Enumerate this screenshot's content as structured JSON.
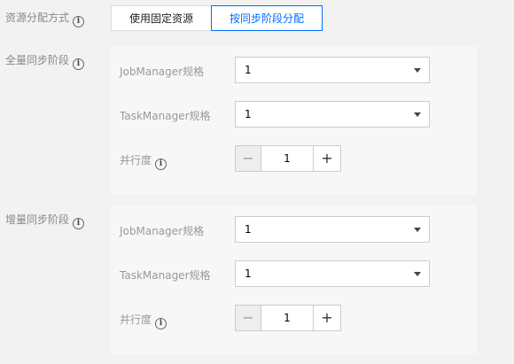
{
  "allocation": {
    "label": "资源分配方式",
    "options": [
      "使用固定资源",
      "按同步阶段分配"
    ],
    "selected": "按同步阶段分配"
  },
  "full_stage": {
    "label": "全量同步阶段",
    "jobmanager_label": "JobManager规格",
    "jobmanager_value": "1",
    "taskmanager_label": "TaskManager规格",
    "taskmanager_value": "1",
    "parallelism_label": "并行度",
    "parallelism_value": "1"
  },
  "incremental_stage": {
    "label": "增量同步阶段",
    "jobmanager_label": "JobManager规格",
    "jobmanager_value": "1",
    "taskmanager_label": "TaskManager规格",
    "taskmanager_value": "1",
    "parallelism_label": "并行度",
    "parallelism_value": "1"
  },
  "stepper": {
    "minus": "−",
    "plus": "+"
  },
  "info_glyph": "i"
}
